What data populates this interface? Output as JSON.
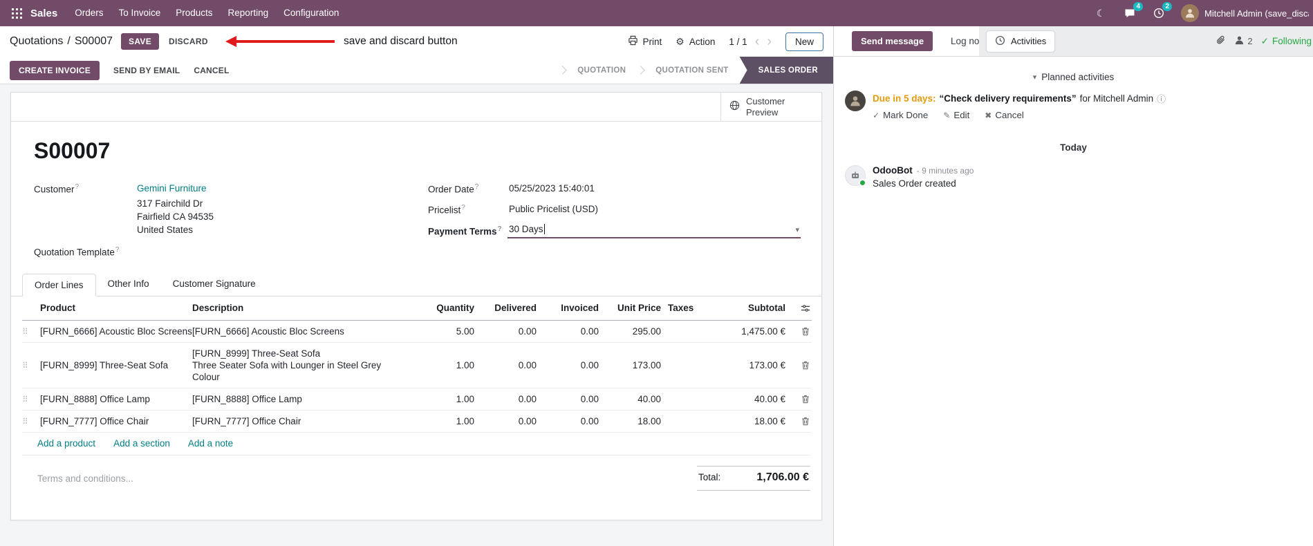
{
  "nav": {
    "app_name": "Sales",
    "menus": [
      "Orders",
      "To Invoice",
      "Products",
      "Reporting",
      "Configuration"
    ],
    "message_badge": "4",
    "activity_badge": "2",
    "user_name": "Mitchell Admin (save_discar"
  },
  "control_panel": {
    "breadcrumb_parent": "Quotations",
    "breadcrumb_sep": "/",
    "breadcrumb_current": "S00007",
    "save_label": "SAVE",
    "discard_label": "DISCARD",
    "print_label": "Print",
    "action_label": "Action",
    "pager": "1 / 1",
    "new_label": "New"
  },
  "annotation": {
    "text": "save and discard button"
  },
  "statusbar": {
    "create_invoice": "CREATE INVOICE",
    "send_by_email": "SEND BY EMAIL",
    "cancel": "CANCEL",
    "stages": [
      {
        "label": "QUOTATION"
      },
      {
        "label": "QUOTATION SENT"
      },
      {
        "label": "SALES ORDER"
      }
    ]
  },
  "form": {
    "customer_preview": "Customer Preview",
    "title": "S00007",
    "help_marker": "?",
    "customer_label": "Customer",
    "customer_name": "Gemini Furniture",
    "address_lines": [
      "317 Fairchild Dr",
      "Fairfield CA 94535",
      "United States"
    ],
    "quotation_template_label": "Quotation Template",
    "order_date_label": "Order Date",
    "order_date_value": "05/25/2023 15:40:01",
    "pricelist_label": "Pricelist",
    "pricelist_value": "Public Pricelist (USD)",
    "payment_terms_label": "Payment Terms",
    "payment_terms_value": "30 Days"
  },
  "tabs": [
    {
      "label": "Order Lines"
    },
    {
      "label": "Other Info"
    },
    {
      "label": "Customer Signature"
    }
  ],
  "order_lines": {
    "headers": {
      "product": "Product",
      "description": "Description",
      "quantity": "Quantity",
      "delivered": "Delivered",
      "invoiced": "Invoiced",
      "unit_price": "Unit Price",
      "taxes": "Taxes",
      "subtotal": "Subtotal"
    },
    "rows": [
      {
        "product": "[FURN_6666] Acoustic Bloc Screens",
        "description": "[FURN_6666] Acoustic Bloc Screens",
        "description2": "",
        "quantity": "5.00",
        "delivered": "0.00",
        "invoiced": "0.00",
        "unit_price": "295.00",
        "taxes": "",
        "subtotal": "1,475.00 €"
      },
      {
        "product": "[FURN_8999] Three-Seat Sofa",
        "description": "[FURN_8999] Three-Seat Sofa",
        "description2": "Three Seater Sofa with Lounger in Steel Grey Colour",
        "quantity": "1.00",
        "delivered": "0.00",
        "invoiced": "0.00",
        "unit_price": "173.00",
        "taxes": "",
        "subtotal": "173.00 €"
      },
      {
        "product": "[FURN_8888] Office Lamp",
        "description": "[FURN_8888] Office Lamp",
        "description2": "",
        "quantity": "1.00",
        "delivered": "0.00",
        "invoiced": "0.00",
        "unit_price": "40.00",
        "taxes": "",
        "subtotal": "40.00 €"
      },
      {
        "product": "[FURN_7777] Office Chair",
        "description": "[FURN_7777] Office Chair",
        "description2": "",
        "quantity": "1.00",
        "delivered": "0.00",
        "invoiced": "0.00",
        "unit_price": "18.00",
        "taxes": "",
        "subtotal": "18.00 €"
      }
    ],
    "add_product": "Add a product",
    "add_section": "Add a section",
    "add_note": "Add a note",
    "terms_placeholder": "Terms and conditions...",
    "total_label": "Total:",
    "total_value": "1,706.00 €"
  },
  "chatter": {
    "send_message": "Send message",
    "log_note": "Log note",
    "activities_tab": "Activities",
    "followers_count": "2",
    "following": "Following",
    "planned_activities": "Planned activities",
    "activity": {
      "due": "Due in 5 days:",
      "summary": "“Check delivery requirements”",
      "assignee": "for Mitchell Admin",
      "mark_done": "Mark Done",
      "edit": "Edit",
      "cancel": "Cancel"
    },
    "date_separator": "Today",
    "message": {
      "author": "OdooBot",
      "time": "- 9 minutes ago",
      "body": "Sales Order created"
    }
  },
  "icons": {
    "gear": "⚙",
    "moon": "☾",
    "drag_handle": "⠿",
    "check": "✓",
    "pencil": "✎",
    "cross": "✖",
    "caret_down": "▾",
    "chevron_left": "‹",
    "chevron_right": "›",
    "info": "ⓘ"
  },
  "colors": {
    "primary": "#714B67",
    "link": "#017e84",
    "modified_value": "#1b6ae0",
    "warning": "#e59b0c",
    "success": "#28a745",
    "badge": "#19b9c3",
    "active_stage": "#5d5064",
    "annotation_arrow": "#e01b1b"
  }
}
